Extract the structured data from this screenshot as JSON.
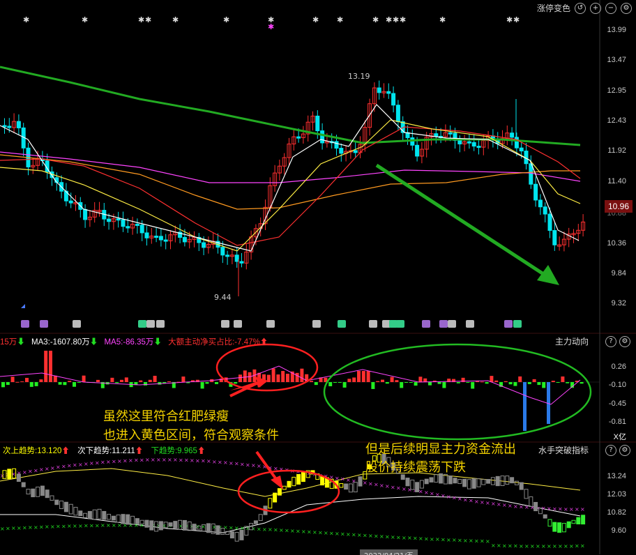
{
  "toolbar": {
    "label": "涨停变色",
    "icons": [
      "undo-icon",
      "plus-icon",
      "minus-icon",
      "gear-icon"
    ]
  },
  "colors": {
    "up": "#ff3030",
    "down": "#00e5ee",
    "ma_green": "#22aa22",
    "annot": "#f5d300",
    "yellow_candle": "#ffff00"
  },
  "price_axis": [
    "13.99",
    "13.47",
    "12.95",
    "12.43",
    "11.92",
    "11.40",
    "10.88",
    "10.36",
    "9.84",
    "9.32"
  ],
  "current_price": "10.96",
  "price_marks": {
    "high": "13.19",
    "low": "9.44"
  },
  "indicator1": {
    "title": "主力动向",
    "legend": [
      {
        "text": "15万",
        "arrow": "down",
        "color": "#ff3030"
      },
      {
        "text": "MA3:-1607.80万",
        "arrow": "down",
        "color": "#ffffff"
      },
      {
        "text": "MA5:-86.35万",
        "arrow": "down",
        "color": "#ff44ff"
      },
      {
        "text": "大额主动净买占比:-7.47%",
        "arrow": "up",
        "color": "#ff3030"
      }
    ],
    "axis": [
      "0.26",
      "-0.10",
      "-0.45",
      "-0.81"
    ],
    "unit": "X亿"
  },
  "indicator2": {
    "title": "水手突破指标",
    "legend": [
      {
        "text": "次上趋势:13.120",
        "arrow": "up",
        "color": "#ffff00"
      },
      {
        "text": "次下趋势:11.211",
        "arrow": "up",
        "color": "#ffffff"
      },
      {
        "text": "下趋势:9.965",
        "arrow": "up",
        "color": "#22dd22"
      }
    ],
    "axis": [
      "13.24",
      "12.03",
      "10.82",
      "9.60"
    ]
  },
  "annotations": {
    "left_line1": "虽然这里符合红肥绿瘦",
    "left_line2": "也进入黄色区间，符合观察条件",
    "right_line1": "但是后续明显主力资金流出",
    "right_line2": "股价持续震荡下跌"
  },
  "bottom_tag": "2022/04/21/五"
}
